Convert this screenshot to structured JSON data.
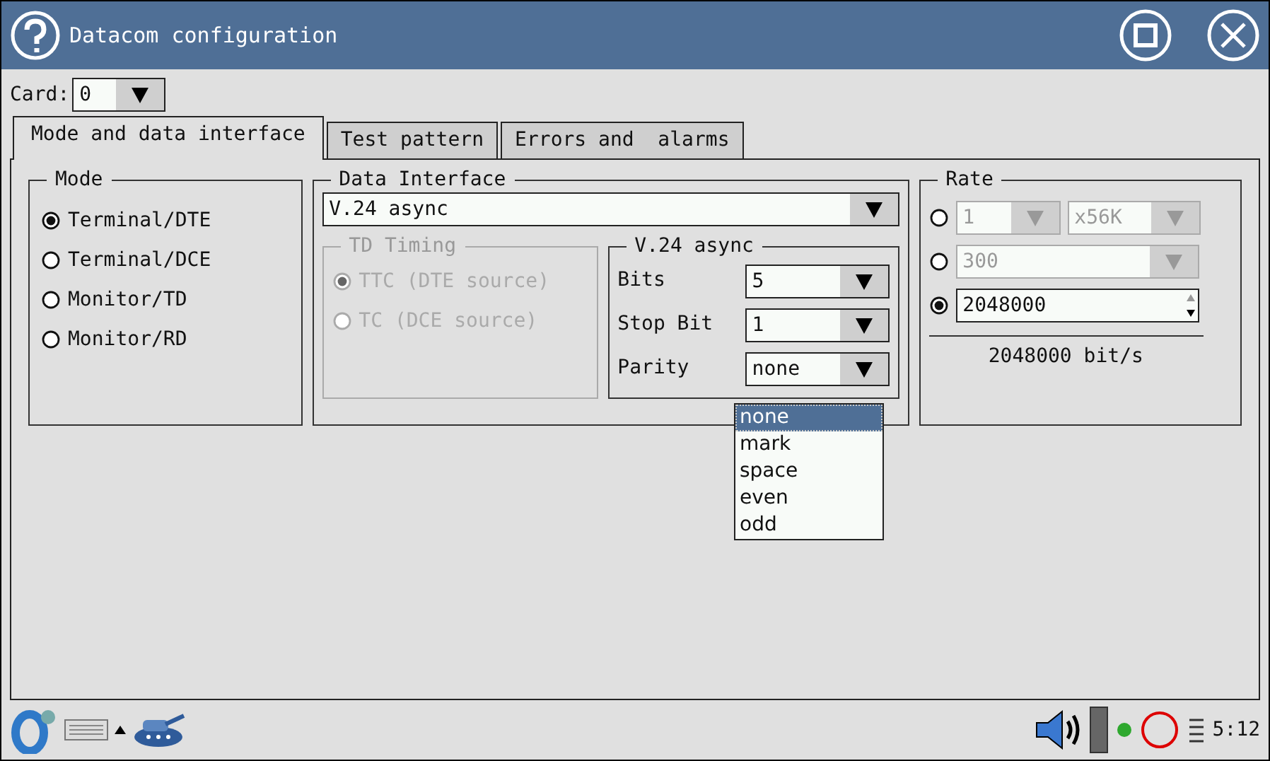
{
  "window": {
    "title": "Datacom configuration"
  },
  "card": {
    "label": "Card:",
    "value": "0"
  },
  "tabs": [
    {
      "label": "Mode and data interface",
      "selected": true
    },
    {
      "label": "Test pattern",
      "selected": false
    },
    {
      "label": "Errors and  alarms",
      "selected": false
    }
  ],
  "mode": {
    "title": "Mode",
    "options": [
      {
        "label": "Terminal/DTE",
        "selected": true
      },
      {
        "label": "Terminal/DCE",
        "selected": false
      },
      {
        "label": "Monitor/TD",
        "selected": false
      },
      {
        "label": "Monitor/RD",
        "selected": false
      }
    ]
  },
  "data_interface": {
    "title": "Data Interface",
    "value": "V.24 async",
    "td_timing": {
      "title": "TD Timing",
      "disabled": true,
      "options": [
        {
          "label": "TTC (DTE source)",
          "selected": true
        },
        {
          "label": "TC (DCE source)",
          "selected": false
        }
      ]
    },
    "settings": {
      "title": "V.24 async",
      "fields": [
        {
          "label": "Bits",
          "value": "5"
        },
        {
          "label": "Stop Bit",
          "value": "1"
        },
        {
          "label": "Parity",
          "value": "none",
          "options": [
            {
              "label": "none",
              "selected": true
            },
            {
              "label": "mark",
              "selected": false
            },
            {
              "label": "space",
              "selected": false
            },
            {
              "label": "even",
              "selected": false
            },
            {
              "label": "odd",
              "selected": false
            }
          ]
        }
      ]
    }
  },
  "rate": {
    "title": "Rate",
    "options": [
      {
        "kind": "multiplier",
        "selected": false,
        "disabled": true,
        "value": "1",
        "unit": "x56K"
      },
      {
        "kind": "select",
        "selected": false,
        "disabled": true,
        "value": "300"
      },
      {
        "kind": "spin",
        "selected": true,
        "disabled": false,
        "value": "2048000"
      }
    ],
    "reading": "2048000 bit/s"
  },
  "taskbar": {
    "clock": "5:12"
  }
}
